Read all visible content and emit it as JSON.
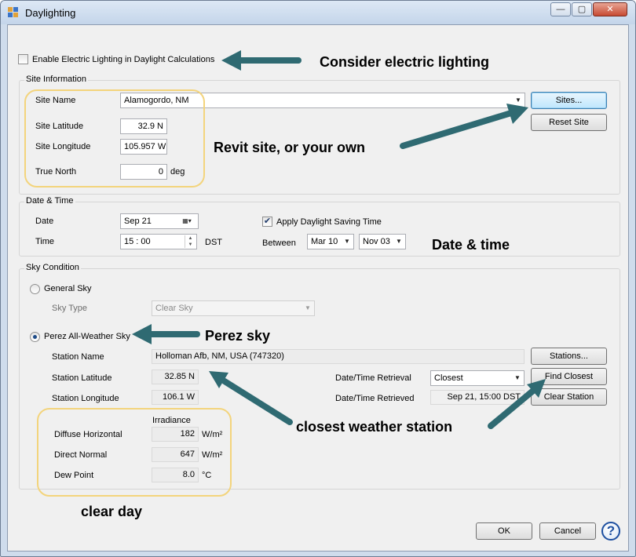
{
  "window": {
    "title": "Daylighting",
    "minimize": "—",
    "maximize": "▢",
    "close": "✕"
  },
  "electric": {
    "label": "Enable Electric Lighting in Daylight Calculations",
    "checked": false
  },
  "site": {
    "group_title": "Site Information",
    "name_label": "Site Name",
    "name_value": "Alamogordo, NM",
    "latitude_label": "Site Latitude",
    "latitude_value": "32.9 N",
    "longitude_label": "Site Longitude",
    "longitude_value": "105.957 W",
    "north_label": "True North",
    "north_value": "0",
    "north_unit": "deg",
    "sites_button": "Sites...",
    "reset_button": "Reset Site"
  },
  "datetime": {
    "group_title": "Date & Time",
    "date_label": "Date",
    "date_value": "Sep 21",
    "time_label": "Time",
    "time_value": "15 : 00",
    "time_suffix": "DST",
    "dst_label": "Apply Daylight Saving Time",
    "dst_checked": true,
    "between_label": "Between",
    "between_start": "Mar 10",
    "between_end": "Nov 03"
  },
  "sky": {
    "group_title": "Sky Condition",
    "general_label": "General Sky",
    "sky_type_label": "Sky Type",
    "sky_type_value": "Clear Sky",
    "perez_label": "Perez All-Weather Sky",
    "selected": "perez",
    "station_name_label": "Station Name",
    "station_name_value": "Holloman Afb, NM, USA (747320)",
    "station_lat_label": "Station Latitude",
    "station_lat_value": "32.85 N",
    "station_lon_label": "Station Longitude",
    "station_lon_value": "106.1 W",
    "retrieval_label": "Date/Time Retrieval",
    "retrieval_value": "Closest",
    "retrieved_label": "Date/Time Retrieved",
    "retrieved_value": "Sep 21, 15:00 DST",
    "stations_button": "Stations...",
    "find_closest_button": "Find Closest",
    "clear_station_button": "Clear Station",
    "irradiance_header": "Irradiance",
    "diffuse_label": "Diffuse Horizontal",
    "diffuse_value": "182",
    "diffuse_unit": "W/m²",
    "direct_label": "Direct Normal",
    "direct_value": "647",
    "direct_unit": "W/m²",
    "dew_label": "Dew Point",
    "dew_value": "8.0",
    "dew_unit": "°C"
  },
  "buttons": {
    "ok": "OK",
    "cancel": "Cancel",
    "help": "?"
  },
  "annotations": {
    "electric": "Consider electric lighting",
    "site": "Revit site, or your own",
    "datetime": "Date & time",
    "perez": "Perez sky",
    "station": "closest weather station",
    "clear_day": "clear day"
  },
  "colors": {
    "arrow": "#2f6a72",
    "highlight": "#f3d47c",
    "focus_border": "#3c7fb1"
  }
}
